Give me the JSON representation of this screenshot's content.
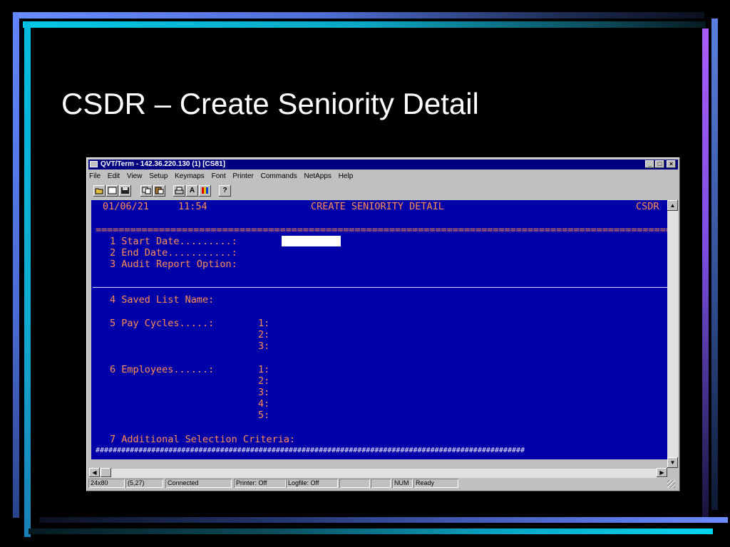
{
  "slide": {
    "title": "CSDR – Create Seniority Detail"
  },
  "window": {
    "title": "QVT/Term - 142.36.220.130 (1) [CS81]",
    "controls": [
      "_",
      "□",
      "×"
    ]
  },
  "menu": [
    "File",
    "Edit",
    "View",
    "Setup",
    "Keymaps",
    "Font",
    "Printer",
    "Commands",
    "NetApps",
    "Help"
  ],
  "toolbar_icons": [
    "open-icon",
    "new-icon",
    "save-icon",
    "copy-icon",
    "paste-icon",
    "print-icon",
    "font-a-icon",
    "color-icon",
    "help-icon"
  ],
  "toolbar_glyphs": {
    "font": "A",
    "help": "?"
  },
  "terminal": {
    "date": "01/06/21",
    "time": "11:54",
    "screen_title": "CREATE SENIORITY DETAIL",
    "screen_code": "CSDR",
    "separator": "====================================================================================================",
    "field1": "1 Start Date.........:",
    "field2": "2 End Date...........:",
    "field3": "3 Audit Report Option:",
    "field4": "4 Saved List Name:",
    "field5": "5 Pay Cycles.....:",
    "pay_cycles": [
      "1:",
      "2:",
      "3:"
    ],
    "field6": "6 Employees......:",
    "employees": [
      "1:",
      "2:",
      "3:",
      "4:",
      "5:"
    ],
    "field7": "7 Additional Selection Criteria:",
    "bottom_fill": "####################################################################################################"
  },
  "status": {
    "size": "24x80",
    "cursor": "(5,27)",
    "connection": "Connected",
    "printer": "Printer: Off",
    "logfile": "Logfile: Off",
    "num": "NUM",
    "state": "Ready"
  }
}
